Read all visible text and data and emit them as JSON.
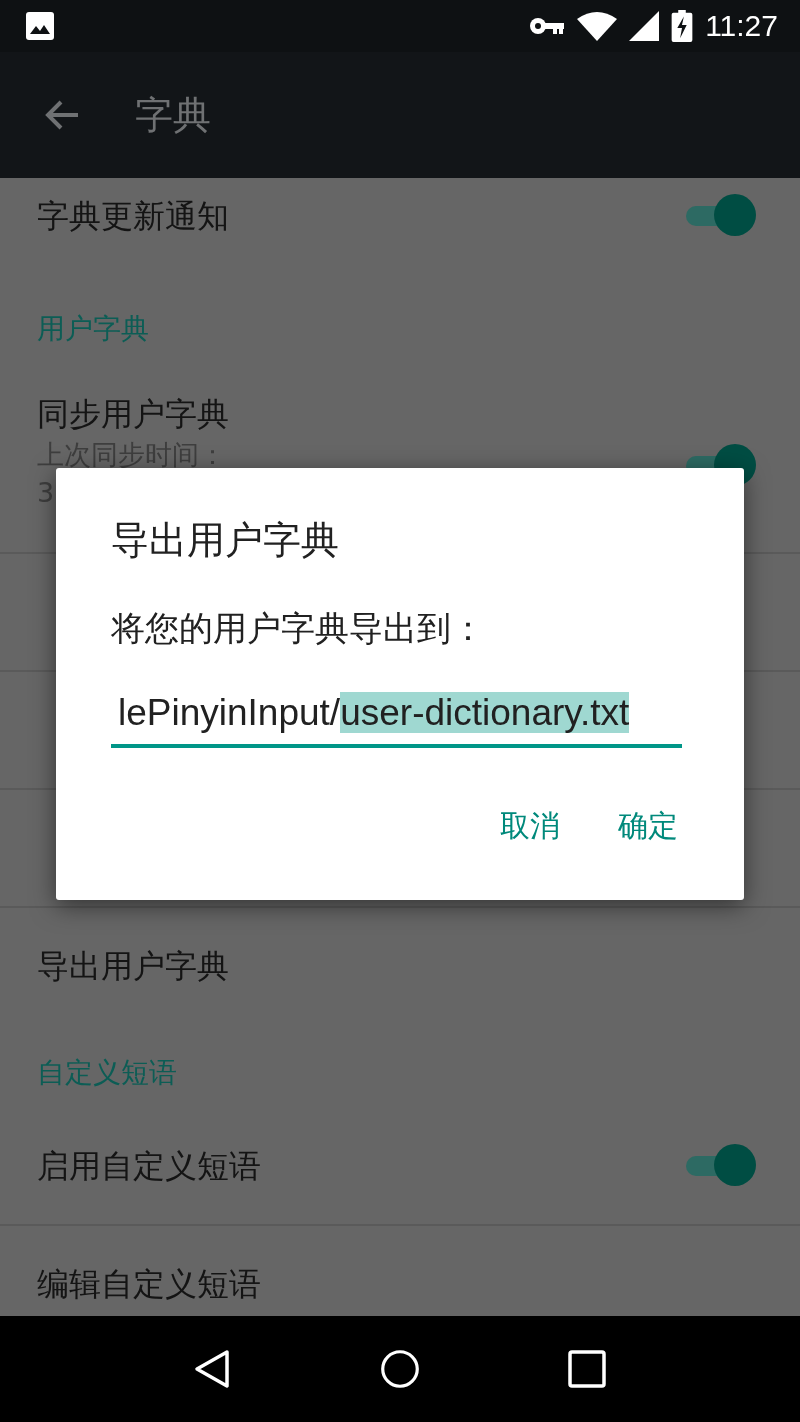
{
  "status_bar": {
    "time": "11:27"
  },
  "app_bar": {
    "title": "字典"
  },
  "settings": [
    {
      "kind": "toggle",
      "title": "字典更新通知",
      "on": true
    },
    {
      "kind": "category",
      "title": "用户字典"
    },
    {
      "kind": "toggle",
      "title": "同步用户字典",
      "subtitle_lines": [
        "上次同步时间：",
        "3"
      ],
      "on": true
    },
    {
      "kind": "item"
    },
    {
      "kind": "item"
    },
    {
      "kind": "item"
    },
    {
      "kind": "item",
      "title": "导出用户字典"
    },
    {
      "kind": "category",
      "title": "自定义短语"
    },
    {
      "kind": "toggle",
      "title": "启用自定义短语",
      "on": true
    },
    {
      "kind": "item",
      "title": "编辑自定义短语"
    }
  ],
  "dialog": {
    "title": "导出用户字典",
    "message": "将您的用户字典导出到：",
    "field": {
      "value": "lePinyinInput/",
      "selected_text": "user-dictionary.txt"
    },
    "buttons": [
      "取消",
      "确定"
    ]
  }
}
